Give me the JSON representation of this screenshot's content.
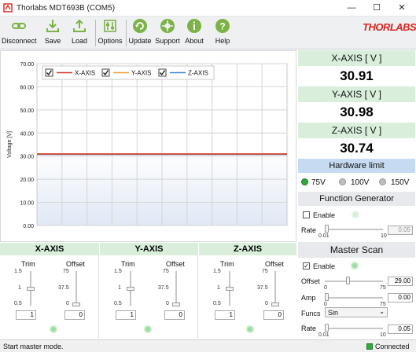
{
  "window": {
    "title": "Thorlabs MDT693B (COM5)"
  },
  "toolbar": {
    "disconnect": "Disconnect",
    "save": "Save",
    "load": "Load",
    "options": "Options",
    "update": "Update",
    "support": "Support",
    "about": "About",
    "help": "Help",
    "logo": "THORLABS"
  },
  "chart_data": {
    "type": "line",
    "ylabel": "Voltage [V]",
    "ylim": [
      0,
      70
    ],
    "yticks": [
      "0.00",
      "10.00",
      "20.00",
      "30.00",
      "40.00",
      "50.00",
      "60.00",
      "70.00"
    ],
    "series": [
      {
        "name": "X-AXIS",
        "color": "#d8342a",
        "y": 30.91,
        "checked": true
      },
      {
        "name": "Y-AXIS",
        "color": "#f0a030",
        "y": 30.98,
        "checked": true
      },
      {
        "name": "Z-AXIS",
        "color": "#3a86c8",
        "y": 30.74,
        "checked": true
      }
    ]
  },
  "readouts": [
    {
      "label": "X-AXIS [ V ]",
      "value": "30.91"
    },
    {
      "label": "Y-AXIS [ V ]",
      "value": "30.98"
    },
    {
      "label": "Z-AXIS [ V ]",
      "value": "30.74"
    }
  ],
  "hardware_limit": {
    "title": "Hardware limit",
    "options": [
      "75V",
      "100V",
      "150V"
    ],
    "selected": "75V"
  },
  "function_generator": {
    "title": "Function Generator",
    "enable_label": "Enable",
    "enabled": false,
    "rate_label": "Rate",
    "rate_min": "0.01",
    "rate_max": "10",
    "rate_value": "0.05",
    "rate_level": 0.0
  },
  "master_scan": {
    "title": "Master Scan",
    "enable_label": "Enable",
    "enabled": true,
    "offset_label": "Offset",
    "offset_min": "0",
    "offset_max": "75",
    "offset_value": "29.00",
    "offset_level": 0.39,
    "amp_label": "Amp",
    "amp_min": "0",
    "amp_max": "75",
    "amp_value": "0.00",
    "amp_level": 0.0,
    "funcs_label": "Funcs",
    "funcs_value": "Sin",
    "rate_label": "Rate",
    "rate_min": "0.01",
    "rate_max": "10",
    "rate_value": "0.05",
    "rate_level": 0.0
  },
  "axes": [
    {
      "title": "X-AXIS",
      "trim_label": "Trim",
      "offset_label": "Offset",
      "trim_ticks": [
        "1.5",
        "1",
        "0.5"
      ],
      "offset_ticks": [
        "75",
        "37.5",
        "0"
      ],
      "trim_value": "1",
      "offset_value": "0",
      "trim_level": 0.5,
      "offset_level": 0.0
    },
    {
      "title": "Y-AXIS",
      "trim_label": "Trim",
      "offset_label": "Offset",
      "trim_ticks": [
        "1.5",
        "1",
        "0.5"
      ],
      "offset_ticks": [
        "75",
        "37.5",
        "0"
      ],
      "trim_value": "1",
      "offset_value": "0",
      "trim_level": 0.5,
      "offset_level": 0.0
    },
    {
      "title": "Z-AXIS",
      "trim_label": "Trim",
      "offset_label": "Offset",
      "trim_ticks": [
        "1.5",
        "1",
        "0.5"
      ],
      "offset_ticks": [
        "75",
        "37.5",
        "0"
      ],
      "trim_value": "1",
      "offset_value": "0",
      "trim_level": 0.5,
      "offset_level": 0.0
    }
  ],
  "status": {
    "message": "Start master mode.",
    "connection": "Connected"
  },
  "colors": {
    "accent_green": "#2fa83c",
    "header_green": "#d9efdc",
    "header_blue": "#c6dbf1",
    "logo_red": "#d7261e"
  }
}
